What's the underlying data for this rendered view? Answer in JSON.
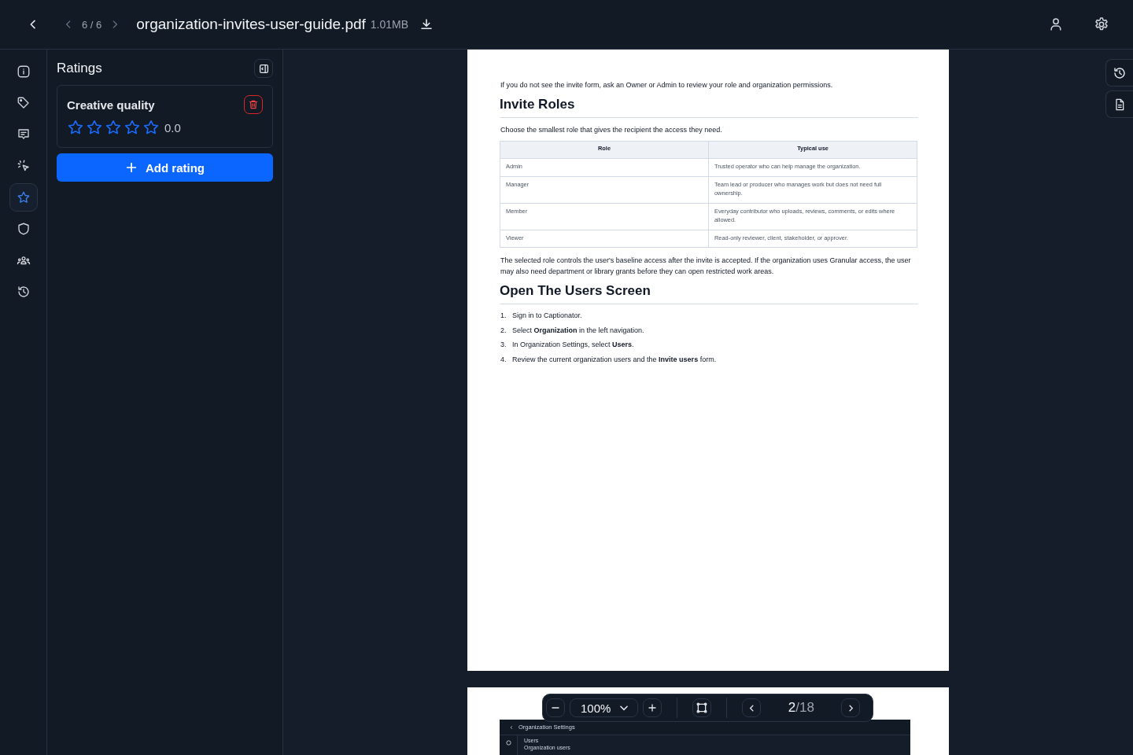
{
  "header": {
    "pager": "6 / 6",
    "file_name": "organization-invites-user-guide.pdf",
    "file_size": "1.01MB"
  },
  "rail": {
    "items": [
      {
        "selected": false
      },
      {
        "selected": false
      },
      {
        "selected": false
      },
      {
        "selected": false
      },
      {
        "selected": true
      },
      {
        "selected": false
      },
      {
        "selected": false
      },
      {
        "selected": false
      }
    ]
  },
  "panel": {
    "title": "Ratings",
    "ratings": [
      {
        "name": "Creative quality",
        "stars": 0,
        "value": "0.0"
      }
    ],
    "add_button": "Add rating"
  },
  "document": {
    "page_one": [
      {
        "kind": "paragraph",
        "text": "If you do not see the invite form, ask an Owner or Admin to review your role and organization permissions."
      },
      {
        "kind": "heading",
        "text": "Invite Roles"
      },
      {
        "kind": "paragraph",
        "text": "Choose the smallest role that gives the recipient the access they need."
      },
      {
        "kind": "table",
        "columns": [
          "Role",
          "Typical use"
        ],
        "rows": [
          [
            "Admin",
            "Trusted operator who can help manage the organization."
          ],
          [
            "Manager",
            "Team lead or producer who manages work but does not need full ownership."
          ],
          [
            "Member",
            "Everyday contributor who uploads, reviews, comments, or edits where allowed."
          ],
          [
            "Viewer",
            "Read-only reviewer, client, stakeholder, or approver."
          ]
        ]
      },
      {
        "kind": "paragraph",
        "text": "The selected role controls the user's baseline access after the invite is accepted. If the organization uses Granular access, the user may also need department or library grants before they can open restricted work areas."
      },
      {
        "kind": "heading",
        "text": "Open The Users Screen"
      },
      {
        "kind": "list",
        "items": [
          {
            "number": "1.",
            "text": "Sign in to Captionator."
          },
          {
            "number": "2.",
            "text": "Select **Organization** in the left navigation."
          },
          {
            "number": "3.",
            "text": "In Organization Settings, select **Users**."
          },
          {
            "number": "4.",
            "text": "Review the current organization users and the **Invite users** form."
          }
        ]
      }
    ],
    "page_two": {
      "screenshot_title": "Organization Settings",
      "screenshot_heading": "Users",
      "screenshot_subheading": "Organization users"
    }
  },
  "zoom_toolbar": {
    "zoom": "100%",
    "page_current": "2",
    "page_total": "/18"
  }
}
